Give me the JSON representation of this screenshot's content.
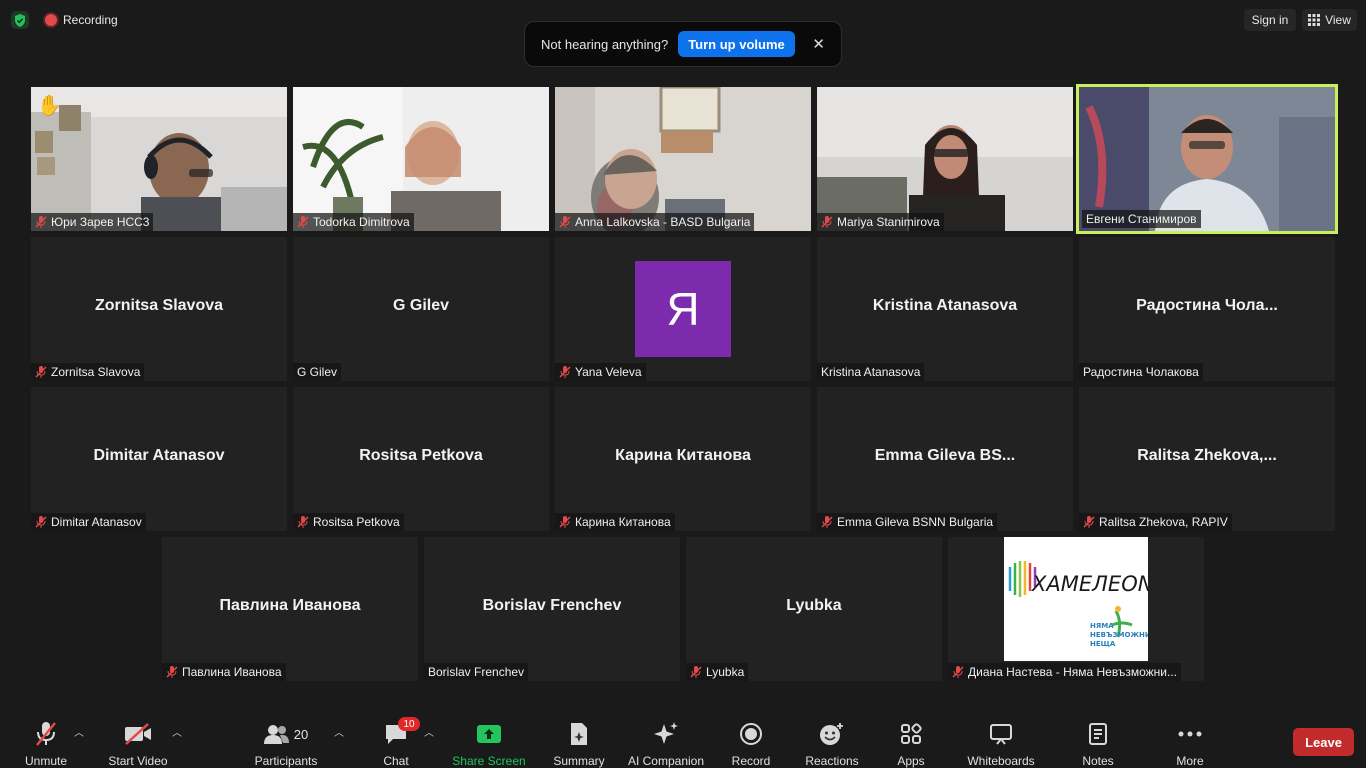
{
  "top": {
    "recording_label": "Recording",
    "notification": {
      "text": "Not hearing anything?",
      "button": "Turn up volume",
      "close": "✕"
    },
    "sign_in": "Sign in",
    "view": "View"
  },
  "tiles": [
    {
      "name": "Юри Зарев НСС3",
      "muted": true,
      "video": true,
      "hand_raised": true
    },
    {
      "name": "Todorka Dimitrova",
      "muted": true,
      "video": true
    },
    {
      "name": "Anna Lalkovska - BASD Bulgaria",
      "muted": true,
      "video": true
    },
    {
      "name": "Mariya Stanimirova",
      "muted": true,
      "video": true
    },
    {
      "name": "Евгени Станимиров",
      "muted": false,
      "video": true,
      "active_speaker": true
    },
    {
      "name": "Zornitsa Slavova",
      "display": "Zornitsa Slavova",
      "muted": true
    },
    {
      "name": "G Gilev",
      "display": "G Gilev",
      "muted": false
    },
    {
      "name": "Yana Veleva",
      "avatar_letter": "Я",
      "muted": true
    },
    {
      "name": "Kristina Atanasova",
      "display": "Kristina Atanasova",
      "muted": false
    },
    {
      "name": "Радостина Чолакова",
      "display": "Радостина  Чола...",
      "muted": false
    },
    {
      "name": "Dimitar Atanasov",
      "display": "Dimitar Atanasov",
      "muted": true
    },
    {
      "name": "Rositsa Petkova",
      "display": "Rositsa Petkova",
      "muted": true
    },
    {
      "name": "Карина Китанова",
      "display": "Карина Китанова",
      "muted": true
    },
    {
      "name": "Emma Gileva BSNN Bulgaria",
      "display": "Emma Gileva BS...",
      "muted": true
    },
    {
      "name": "Ralitsa Zhekova, RAPIV",
      "display": "Ralitsa  Zhekova,...",
      "muted": true
    },
    {
      "name": "Павлина Иванова",
      "display": "Павлина Иванова",
      "muted": true
    },
    {
      "name": "Borislav Frenchev",
      "display": "Borislav Frenchev",
      "muted": false
    },
    {
      "name": "Lyubka",
      "display": "Lyubka",
      "muted": true
    },
    {
      "name": "Диана Настева -  Няма Невъзможни...",
      "muted": true,
      "logo": {
        "title": "ХАМЕЛЕОN",
        "line1": "НЯМА",
        "line2": "НЕВЪЗМОЖНИ",
        "line3": "НЕЩА"
      }
    }
  ],
  "toolbar": {
    "unmute": "Unmute",
    "start_video": "Start Video",
    "participants": "Participants",
    "participants_count": "20",
    "chat": "Chat",
    "chat_badge": "10",
    "share_screen": "Share Screen",
    "summary": "Summary",
    "ai_companion": "AI Companion",
    "record": "Record",
    "reactions": "Reactions",
    "apps": "Apps",
    "whiteboards": "Whiteboards",
    "notes": "Notes",
    "more": "More",
    "leave": "Leave"
  },
  "colors": {
    "accent_blue": "#0e72ed",
    "active_border": "#c9ef5d",
    "leave_red": "#c22b2b",
    "share_green": "#22c55e",
    "muted_red": "#e04a4a",
    "avatar_purple": "#7b2bab"
  }
}
